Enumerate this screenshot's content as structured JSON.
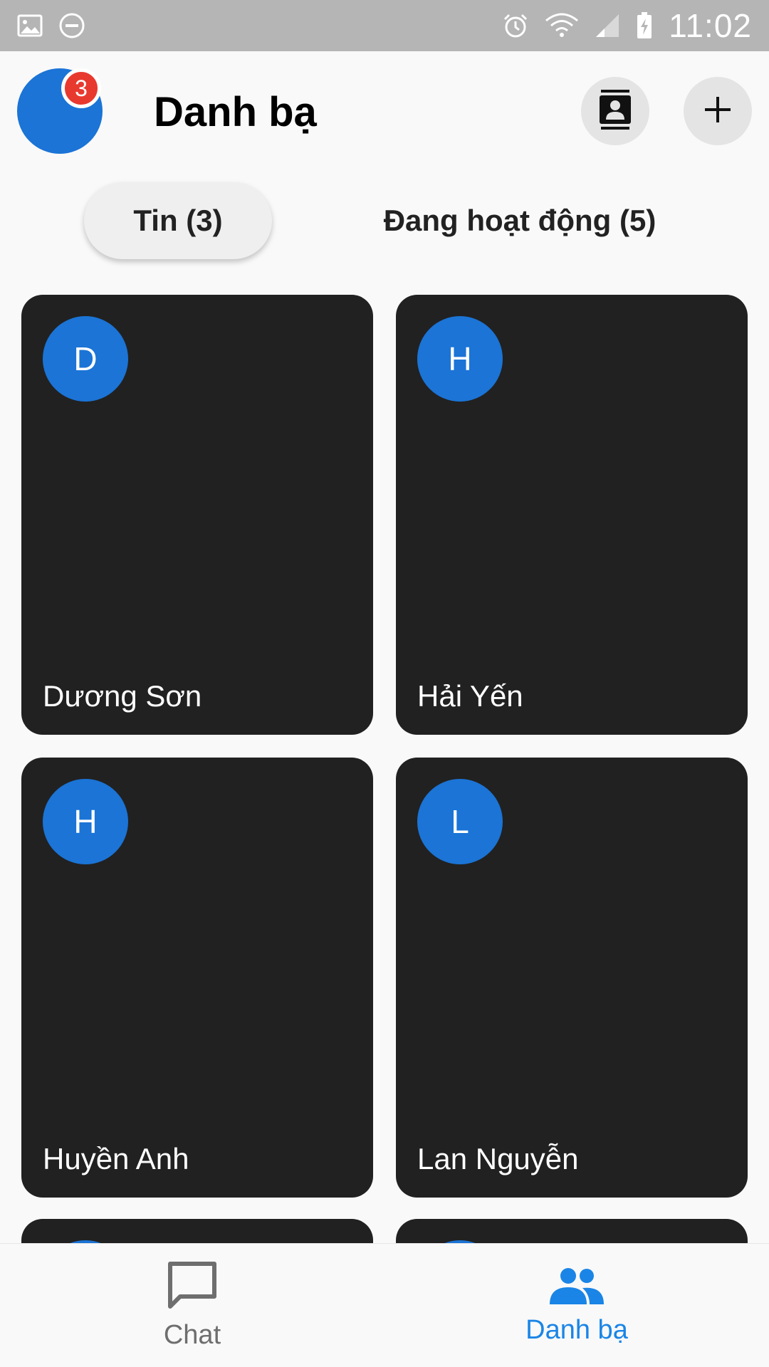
{
  "status_bar": {
    "time": "11:02",
    "icons": [
      "image-icon",
      "do-not-disturb-icon",
      "alarm-icon",
      "wifi-icon",
      "signal-icon",
      "battery-charging-icon"
    ]
  },
  "header": {
    "title": "Danh bạ",
    "notification_count": "3",
    "contacts_button_icon": "contact-book-icon",
    "add_button_icon": "plus-icon"
  },
  "tabs": [
    {
      "label": "Tin (3)",
      "selected": true
    },
    {
      "label": "Đang hoạt động (5)",
      "selected": false
    }
  ],
  "contacts": [
    {
      "initial": "D",
      "name": "Dương Sơn"
    },
    {
      "initial": "H",
      "name": "Hải Yến"
    },
    {
      "initial": "H",
      "name": "Huyền Anh"
    },
    {
      "initial": "L",
      "name": "Lan Nguyễn"
    }
  ],
  "bottom_nav": [
    {
      "label": "Chat",
      "icon": "chat-bubble-icon",
      "active": false
    },
    {
      "label": "Danh bạ",
      "icon": "people-icon",
      "active": true
    }
  ],
  "colors": {
    "accent": "#1a85e6",
    "avatar": "#1b74d6",
    "card": "#212121",
    "badge": "#e8392f"
  }
}
